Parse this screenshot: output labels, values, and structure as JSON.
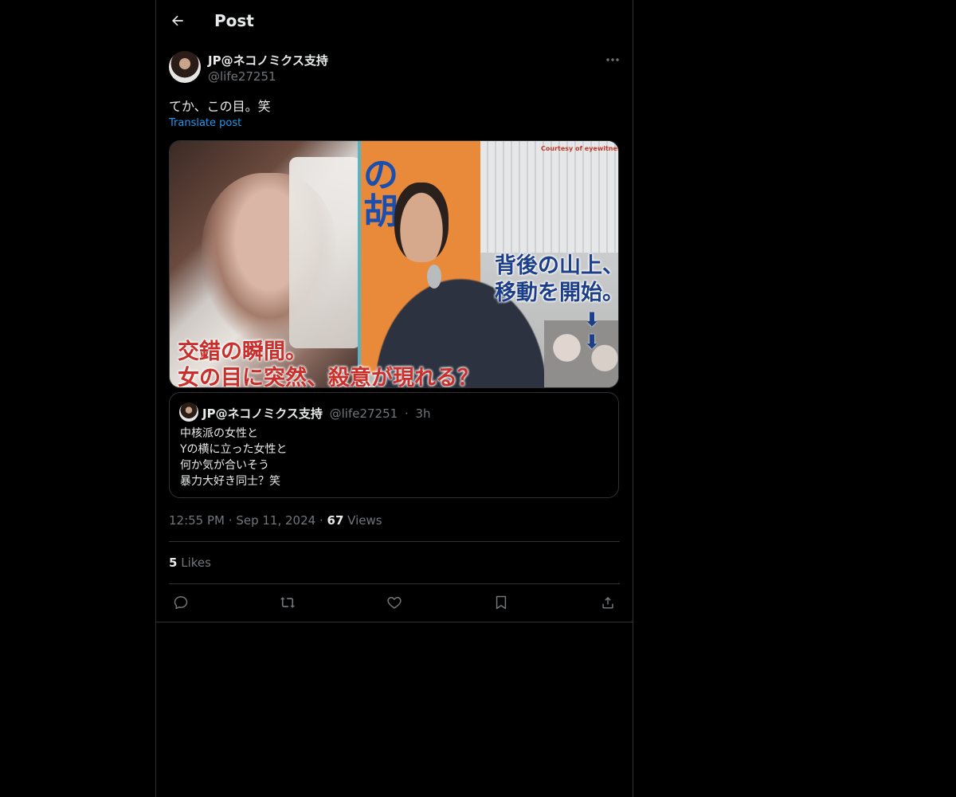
{
  "header": {
    "title": "Post"
  },
  "post": {
    "author_name": "JP@ネコノミクス支持",
    "author_handle": "@life27251",
    "text": "てか、この目。笑",
    "translate_label": "Translate post",
    "media": {
      "caption_left_line1": "交錯の瞬間。",
      "caption_left_line2": "女の目に突然、殺意が現れる？",
      "caption_right_line1": "背後の山上、",
      "caption_right_line2": "移動を開始。",
      "banner_text": "の胡",
      "courtesy": "Courtesy of eyewitness",
      "arrows": "⬇ ⬇"
    },
    "quote": {
      "author_name": "JP@ネコノミクス支持",
      "author_handle": "@life27251",
      "dot": "·",
      "time": "3h",
      "lines": [
        "中核派の女性と",
        "Yの横に立った女性と",
        "何か気が合いそう",
        "暴力大好き同士？笑"
      ]
    },
    "meta": {
      "time": "12:55 PM",
      "dot1": "·",
      "date": "Sep 11, 2024",
      "dot2": "·",
      "views_count": "67",
      "views_label": "Views"
    },
    "likes": {
      "count": "5",
      "label": "Likes"
    }
  },
  "icons": {
    "back": "arrow-left-icon",
    "more": "more-horizontal-icon",
    "reply": "reply-icon",
    "repost": "repost-icon",
    "like": "heart-icon",
    "bookmark": "bookmark-icon",
    "share": "share-icon"
  },
  "colors": {
    "background": "#000000",
    "text": "#e7e9ea",
    "secondary": "#71767b",
    "link": "#1d9bf0",
    "border": "#2f3336"
  }
}
